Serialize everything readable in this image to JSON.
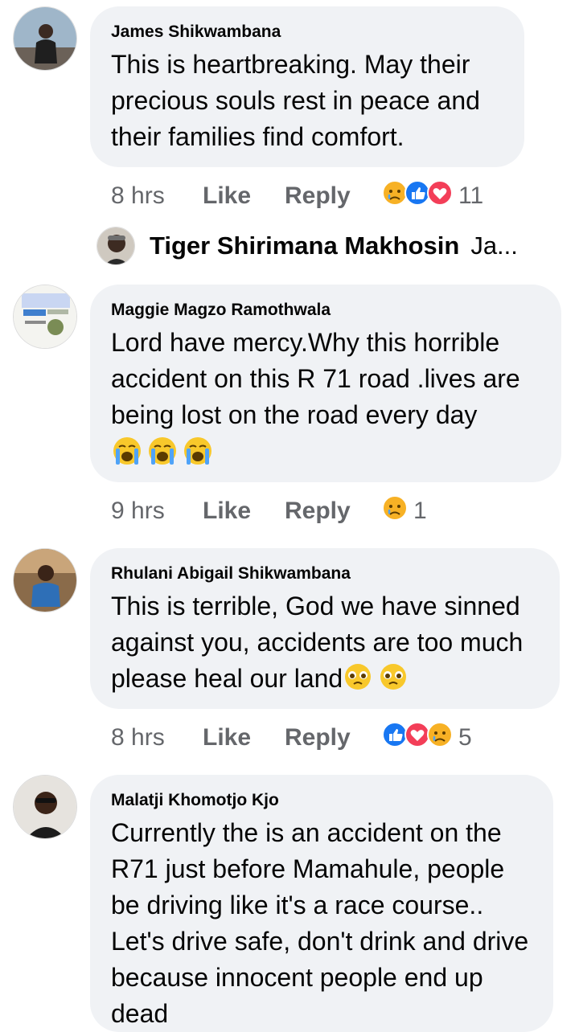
{
  "comments": [
    {
      "author": "James Shikwambana",
      "text": "This is heartbreaking. May their precious souls rest in peace and their families find comfort.",
      "time": "8 hrs",
      "like_label": "Like",
      "reply_label": "Reply",
      "reaction_icons": [
        "sad-reaction-icon",
        "like-reaction-icon",
        "love-reaction-icon"
      ],
      "reaction_count": "11"
    },
    {
      "author": "Maggie Magzo Ramothwala",
      "text": "Lord have mercy.Why this horrible accident on this R 71 road .lives are being lost on the road every day",
      "emojis": [
        "crying-face-icon",
        "crying-face-icon",
        "crying-face-icon"
      ],
      "time": "9 hrs",
      "like_label": "Like",
      "reply_label": "Reply",
      "reaction_icons": [
        "sad-reaction-icon"
      ],
      "reaction_count": "1"
    },
    {
      "author": "Rhulani Abigail Shikwambana",
      "text": "This is terrible, God we have sinned against you, accidents are too much please heal our land",
      "emojis": [
        "pleading-face-icon",
        "pleading-face-icon"
      ],
      "time": "8 hrs",
      "like_label": "Like",
      "reply_label": "Reply",
      "reaction_icons": [
        "like-reaction-icon",
        "love-reaction-icon",
        "sad-reaction-icon"
      ],
      "reaction_count": "5"
    },
    {
      "author": "Malatji Khomotjo Kjo",
      "text": "Currently the is an accident on the R71 just before Mamahule, people be driving like it's a race course.. Let's  drive safe, don't drink and drive because innocent people end up dead"
    }
  ],
  "reply_preview": {
    "author": "Tiger Shirimana Makhosin",
    "snippet": "Ja..."
  },
  "colors": {
    "bubble": "#f0f2f5",
    "meta_text": "#65676b",
    "like_blue": "#1877f2",
    "love_red": "#f33e58",
    "sad_yellow": "#f7b125"
  }
}
